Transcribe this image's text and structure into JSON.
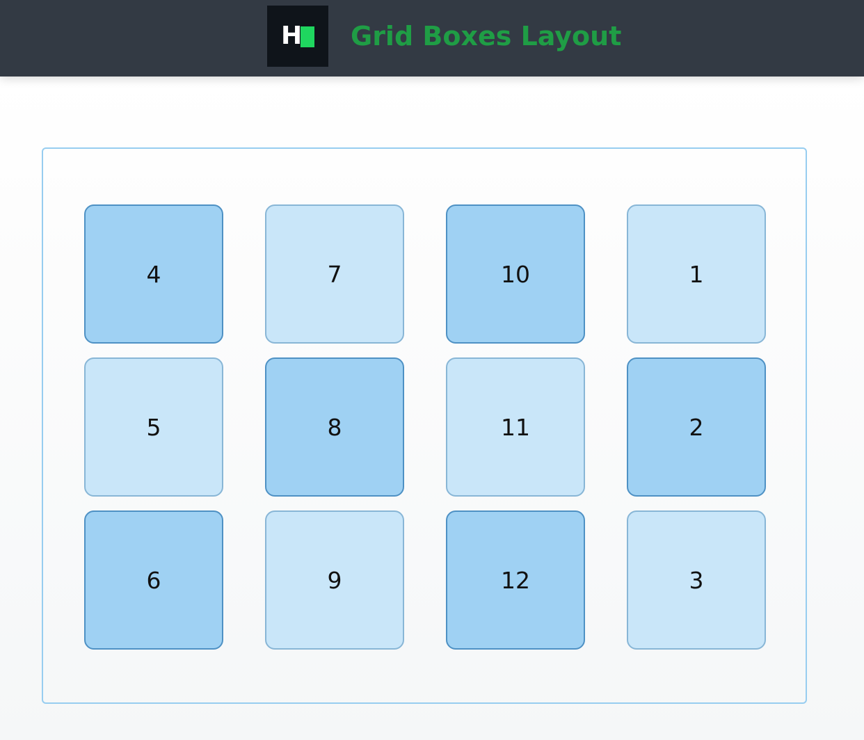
{
  "header": {
    "logo_text": "H",
    "title": "Grid Boxes Layout",
    "title_color": "#1f9d45",
    "bar_color": "#333a44"
  },
  "grid": {
    "rows": [
      [
        "4",
        "7",
        "10",
        "1"
      ],
      [
        "5",
        "8",
        "11",
        "2"
      ],
      [
        "6",
        "9",
        "12",
        "3"
      ]
    ],
    "dark_color": "#9fd1f3",
    "light_color": "#c9e6f9",
    "border_color": "#97cdf0"
  }
}
